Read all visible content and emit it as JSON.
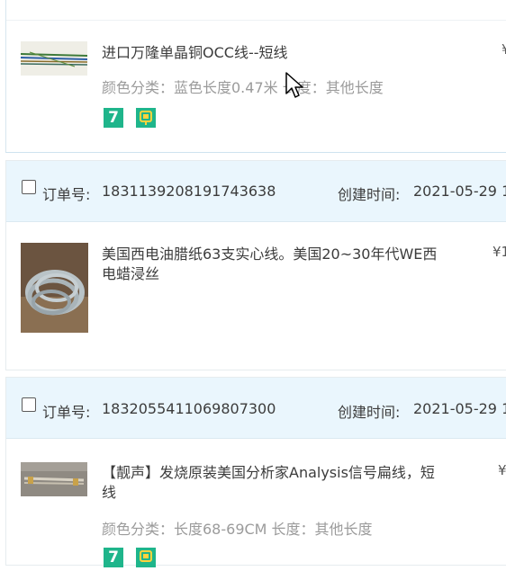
{
  "top_item": {
    "title": "进口万隆单晶铜OCC线--短线",
    "spec": "颜色分类：蓝色长度0.47米 长度：其他长度",
    "price": "¥",
    "badges": [
      "service-7-icon",
      "guarantee-icon"
    ]
  },
  "orders": [
    {
      "order_no_label": "订单号:",
      "order_no": "1831139208191743638",
      "created_label": "创建时间:",
      "created": "2021-05-29 1",
      "item": {
        "title_line1": "美国西电油腊纸63支实心线。美国20~30年代WE西",
        "title_line2": "电蜡浸丝",
        "price": "¥1"
      }
    },
    {
      "order_no_label": "订单号:",
      "order_no": "1832055411069807300",
      "created_label": "创建时间:",
      "created": "2021-05-29 1",
      "item": {
        "title_line1": "【靓声】发烧原装美国分析家Analysis信号扁线，短",
        "title_line2": "线",
        "spec": "颜色分类：长度68-69CM 长度：其他长度",
        "price": "¥"
      }
    }
  ],
  "colors": {
    "header_bg": "#eaf6fd",
    "badge_green": "#1fb58b",
    "spec_gray": "#9b9b9b"
  }
}
